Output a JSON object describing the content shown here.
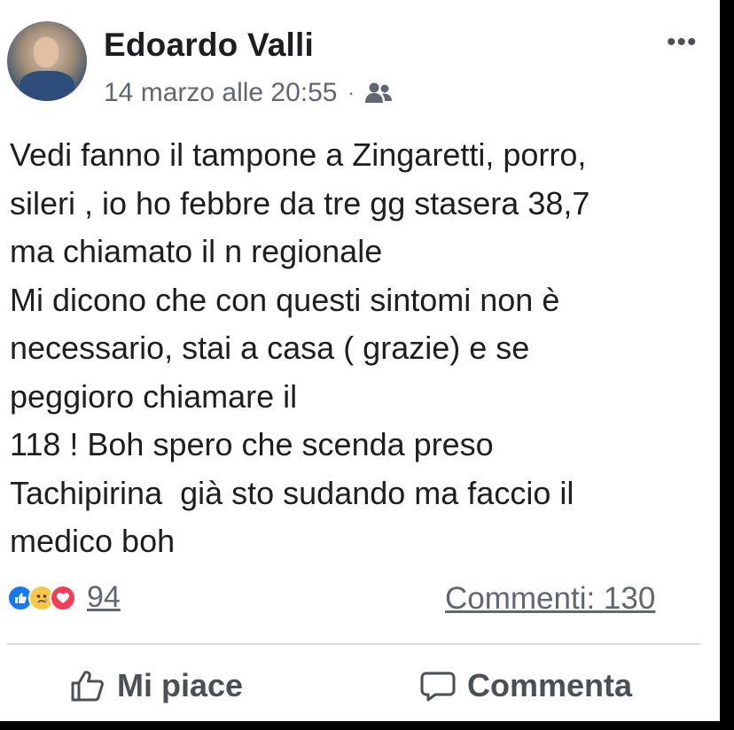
{
  "post": {
    "author": "Edoardo Valli",
    "timestamp": "14 marzo alle 20:55",
    "separator": "·",
    "audience_icon": "friends-icon",
    "more_icon": "more-options-icon",
    "more_glyph": "•••",
    "text_lines": [
      "Vedi fanno il tampone a Zingaretti, porro,",
      "sileri , io ho febbre da tre gg stasera 38,7",
      "ma chiamato il n regionale",
      "Mi dicono che con questi sintomi non è",
      "necessario, stai a casa ( grazie) e se",
      "peggioro chiamare il",
      "118 ! Boh spero che scenda preso",
      "Tachipirina  già sto sudando ma faccio il",
      "medico boh"
    ]
  },
  "reactions": {
    "icons": [
      "like-reaction-icon",
      "sad-reaction-icon",
      "love-reaction-icon"
    ],
    "count": "94"
  },
  "comments": {
    "label": "Commenti: 130"
  },
  "actions": {
    "like_label": "Mi piace",
    "comment_label": "Commenta"
  },
  "colors": {
    "background": "#ffffff",
    "text": "#1c1e21",
    "secondary_text": "#606770",
    "like_blue": "#1877f2",
    "sad_yellow": "#f7c749",
    "love_red": "#f33e58"
  }
}
